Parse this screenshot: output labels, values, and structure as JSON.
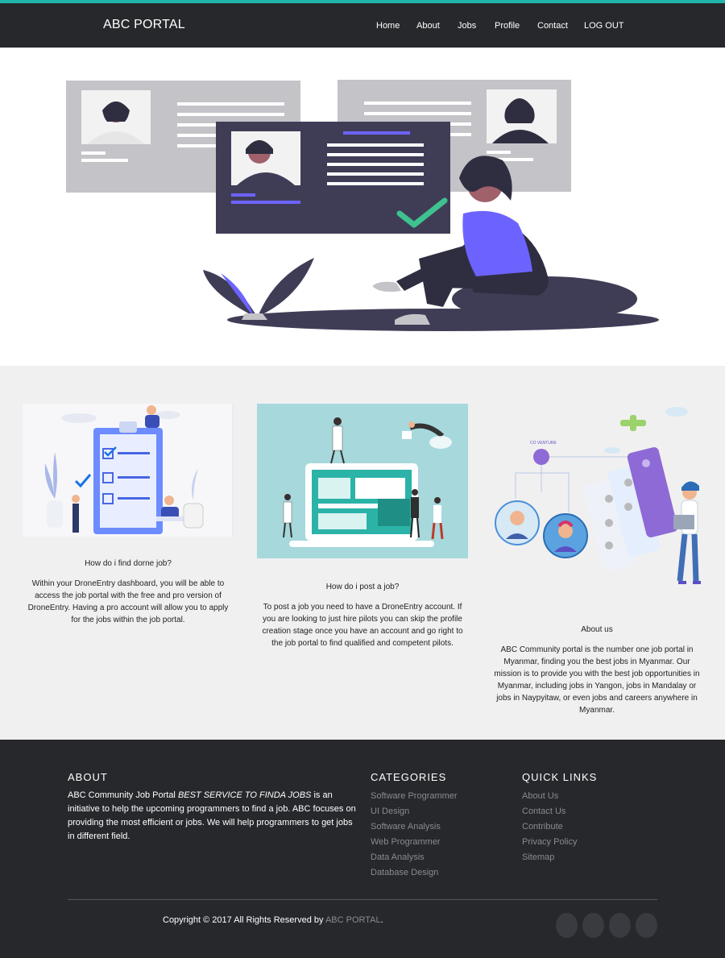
{
  "header": {
    "brand": "ABC PORTAL",
    "nav": [
      "Home",
      "About",
      "Jobs",
      "Profile",
      "Contact",
      "LOG OUT"
    ]
  },
  "features": [
    {
      "title": "How do i find dorne job?",
      "text": "Within your DroneEntry dashboard, you will be able to access the job portal with the free and pro version of DroneEntry. Having a pro account will allow you to apply for the jobs within the job portal."
    },
    {
      "title": "How do i post a job?",
      "text": "To post a job you need to have a DroneEntry account. If you are looking to just hire pilots you can skip the profile creation stage once you have an account and go right to the job portal to find qualified and competent pilots."
    },
    {
      "title": "About us",
      "text": "ABC Community portal is the number one job portal in Myanmar, finding you the best jobs in Myanmar. Our mission is to provide you with the best job opportunities in Myanmar, including jobs in Yangon, jobs in Mandalay or jobs in Naypyitaw, or even jobs and careers anywhere in Myanmar.",
      "illustration_label": "CO VENTURE"
    }
  ],
  "footer": {
    "about": {
      "heading": "ABOUT",
      "text_start": "ABC Community Job Portal ",
      "text_emph": "BEST SERVICE TO FINDA JOBS",
      "text_end": " is an initiative to help the upcoming programmers to find a job. ABC focuses on providing the most efficient or jobs. We will help programmers to get jobs in different field."
    },
    "categories": {
      "heading": "CATEGORIES",
      "items": [
        "Software Programmer",
        "UI Design",
        "Software Analysis",
        "Web Programmer",
        "Data Analysis",
        "Database Design"
      ]
    },
    "quick_links": {
      "heading": "QUICK LINKS",
      "items": [
        "About Us",
        "Contact Us",
        "Contribute",
        "Privacy Policy",
        "Sitemap"
      ]
    },
    "copyright_prefix": "Copyright © 2017 All Rights Reserved by ",
    "copyright_brand": "ABC PORTAL",
    "copyright_suffix": ".",
    "social_icons": [
      "social-icon-1",
      "social-icon-2",
      "social-icon-3",
      "social-icon-4"
    ]
  },
  "colors": {
    "accent": "#1fb5ac",
    "dark": "#27282c",
    "purple": "#6c63ff",
    "illustration_dark": "#3f3d56"
  }
}
